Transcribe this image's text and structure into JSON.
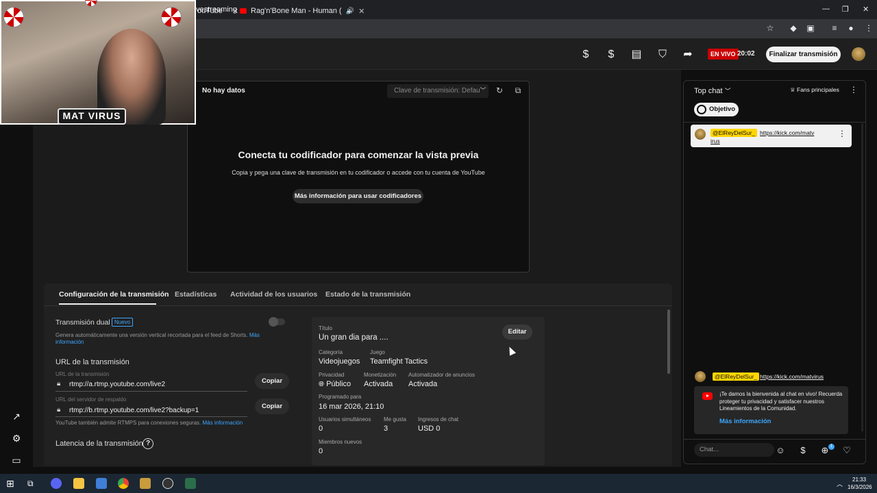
{
  "browser": {
    "tabs": [
      {
        "label": "ouTube"
      },
      {
        "label": "Rag'n'Bone Man - Human ("
      }
    ],
    "address": "vestreaming"
  },
  "header": {
    "live_badge": "EN VIVO",
    "live_time": "20:02",
    "end_button": "Finalizar transmisión"
  },
  "preview": {
    "status": "No hay datos",
    "key_select": "Clave de transmisión: Defau",
    "title": "Conecta tu codificador para comenzar la vista previa",
    "subtitle": "Copia y pega una clave de transmisión en tu codificador o accede con tu cuenta de YouTube",
    "more_button": "Más información para usar codificadores"
  },
  "tabs": [
    {
      "label": "Configuración de la transmisión"
    },
    {
      "label": "Estadísticas"
    },
    {
      "label": "Actividad de los usuarios"
    },
    {
      "label": "Estado de la transmisión"
    }
  ],
  "settings": {
    "dual_label": "Transmisión dual",
    "dual_badge": "Nuevo",
    "dual_desc": "Genera automáticamente una versión vertical recortada para el feed de Shorts.",
    "dual_more": "Más",
    "dual_more2": "información",
    "url_heading": "URL de la transmisión",
    "url_label": "URL de la transmisión",
    "url_value": "rtmp://a.rtmp.youtube.com/live2",
    "backup_label": "URL del servidor de respaldo",
    "backup_value": "rtmp://b.rtmp.youtube.com/live2?backup=1",
    "copy": "Copiar",
    "rtmps_note": "YouTube también admite RTMPS para conexiones seguras.",
    "rtmps_link": "Más información",
    "latency_heading": "Latencia de la transmisión"
  },
  "info": {
    "title_key": "Título",
    "title_val": "Un gran dia para ....",
    "edit": "Editar",
    "category_key": "Categoría",
    "category_val": "Videojuegos",
    "game_key": "Juego",
    "game_val": "Teamfight Tactics",
    "privacy_key": "Privacidad",
    "privacy_val": "Público",
    "monet_key": "Monetización",
    "monet_val": "Activada",
    "ads_key": "Automatizador de anuncios",
    "ads_val": "Activada",
    "scheduled_key": "Programado para",
    "scheduled_val": "16 mar 2026, 21:10",
    "viewers_key": "Usuarios simultáneos",
    "viewers_val": "0",
    "likes_key": "Me gusta",
    "likes_val": "3",
    "chat_income_key": "Ingresos de chat",
    "chat_income_val": "USD 0",
    "new_members_key": "Miembros nuevos",
    "new_members_val": "0"
  },
  "chat": {
    "title": "Top chat",
    "fans": "Fans principales",
    "objective": "Objetivo",
    "pinned_author": "@ElReyDelSur_",
    "pinned_msg_1": "https://kick.com/matv",
    "pinned_msg_2": "irus",
    "msg_author": "@ElReyDelSur_",
    "msg_text": "https://kick.com/matvirus",
    "welcome": "¡Te damos la bienvenida al chat en vivo! Recuerda proteger tu privacidad y satisfacer nuestros Lineamientos de la Comunidad.",
    "welcome_link": "Más información",
    "input_placeholder": "Chat...",
    "badge_count": "1"
  },
  "webcam": {
    "name": "MAT VIRUS"
  },
  "taskbar": {
    "time": "21:33",
    "date": "16/3/2026"
  }
}
